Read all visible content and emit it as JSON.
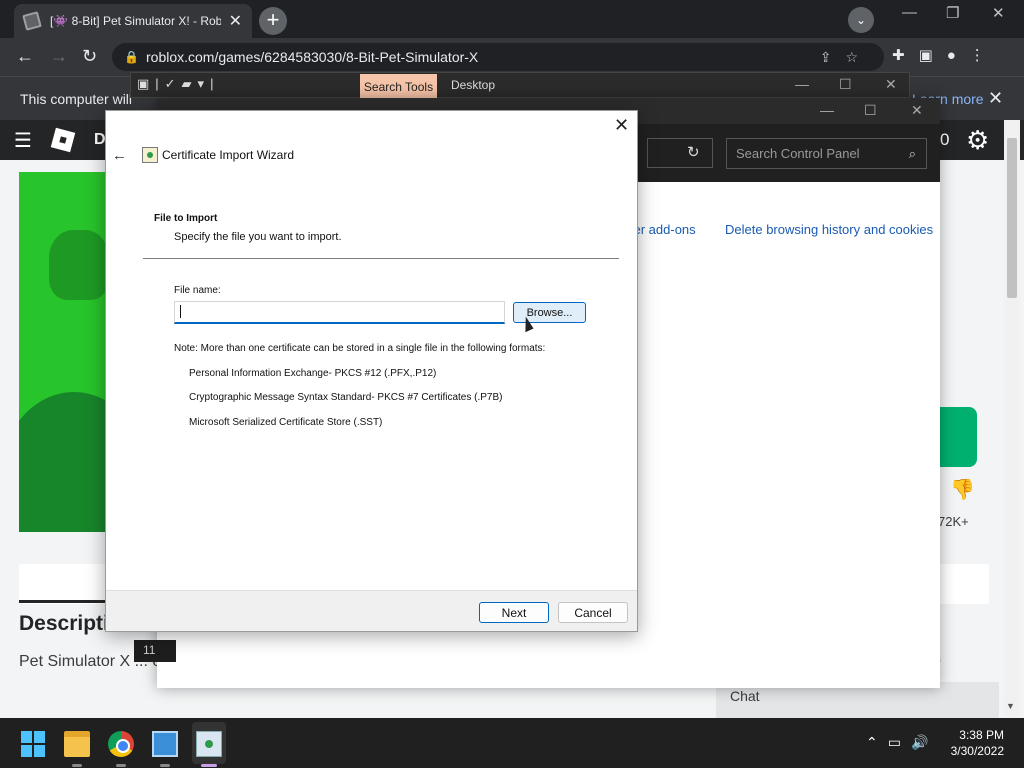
{
  "browser": {
    "tab_title": "[👾 8-Bit] Pet Simulator X! - Robl",
    "tab_close": "✕",
    "new_tab": "+",
    "url": "roblox.com/games/6284583030/8-Bit-Pet-Simulator-X",
    "infobar_text": "This computer will",
    "infobar_link": "Learn more"
  },
  "explorer_strip": {
    "search_tools": "Search Tools",
    "desktop": "Desktop"
  },
  "control_panel": {
    "search_placeholder": "Search Control Panel",
    "link_addons": "ser add-ons",
    "link_delete": "Delete browsing history and cookies",
    "bottom_strip": "11"
  },
  "roblox": {
    "nav_letter": "D",
    "robux": "0",
    "description_title": "Description",
    "description_text": "Pet Simulator X ... explore, and hun",
    "description_right": "o",
    "votes": "72K+",
    "chat": "Chat"
  },
  "wizard": {
    "title": "Certificate Import Wizard",
    "heading": "File to Import",
    "subheading": "Specify the file you want to import.",
    "file_name_label": "File name:",
    "file_name_value": "",
    "browse": "Browse...",
    "note": "Note:  More than one certificate can be stored in a single file in the following formats:",
    "formats": [
      "Personal Information Exchange- PKCS #12 (.PFX,.P12)",
      "Cryptographic Message Syntax Standard- PKCS #7 Certificates (.P7B)",
      "Microsoft Serialized Certificate Store (.SST)"
    ],
    "next": "Next",
    "cancel": "Cancel"
  },
  "taskbar": {
    "time": "3:38 PM",
    "date": "3/30/2022"
  },
  "colors": {
    "accent": "#0067c0",
    "roblox_green": "#00b06f",
    "search_tools_bg": "#f6c4a8"
  }
}
